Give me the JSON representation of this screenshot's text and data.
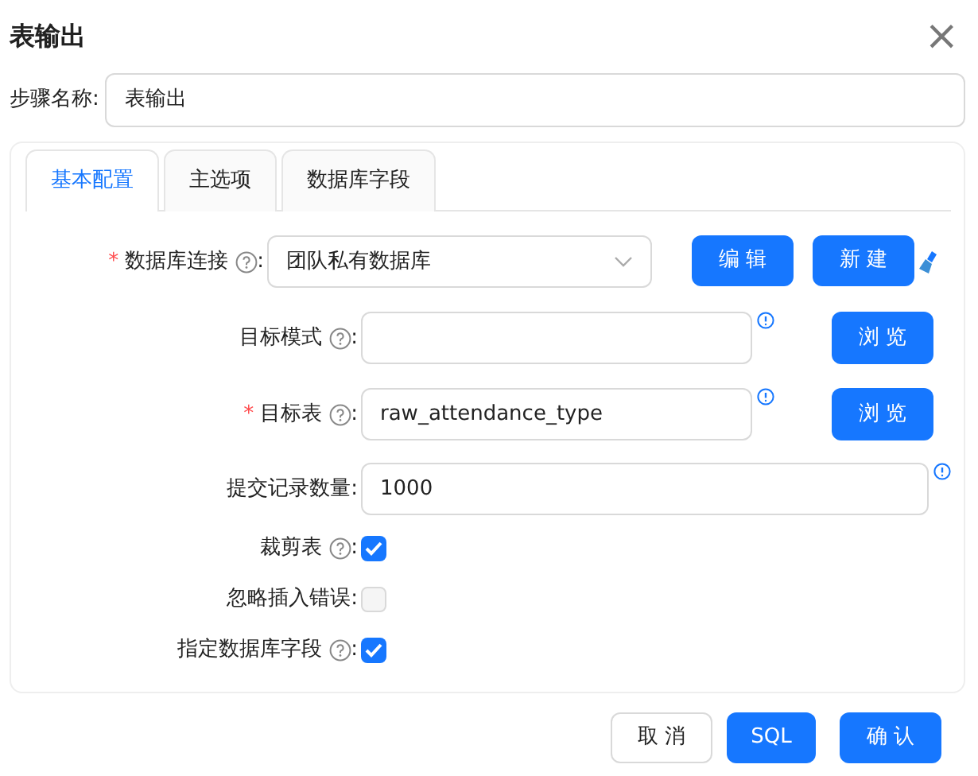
{
  "dialog": {
    "title": "表输出",
    "close": "×"
  },
  "step_name": {
    "label": "步骤名称:",
    "value": "表输出"
  },
  "tabs": [
    {
      "label": "基本配置",
      "selected": true
    },
    {
      "label": "主选项",
      "selected": false
    },
    {
      "label": "数据库字段",
      "selected": false
    }
  ],
  "fields": [
    {
      "kind": "select",
      "required_mark": "*",
      "label": "数据库连接",
      "help": true,
      "colon": ":",
      "value": "团队私有数据库",
      "buttons": [
        "编 辑",
        "新 建"
      ]
    },
    {
      "kind": "text",
      "label": "目标模式",
      "help": true,
      "colon": ":",
      "info": true,
      "buttons": [
        "浏 览"
      ]
    },
    {
      "kind": "text",
      "required_mark": "*",
      "label": "目标表",
      "help": true,
      "colon": ":",
      "value": "raw_attendance_type",
      "info": true,
      "buttons": [
        "浏 览"
      ]
    },
    {
      "kind": "wide",
      "label": "提交记录数量",
      "help": false,
      "colon": ":",
      "value": "1000",
      "info": true
    },
    {
      "kind": "checkbox",
      "label": "裁剪表",
      "help": true,
      "colon": ":",
      "checked": true
    },
    {
      "kind": "checkbox",
      "label": "忽略插入错误",
      "help": false,
      "colon": ":",
      "checked": false
    },
    {
      "kind": "checkbox",
      "label": "指定数据库字段",
      "help": true,
      "colon": ":",
      "checked": true
    }
  ],
  "footer_buttons": [
    {
      "label": "取 消",
      "kind": "default"
    },
    {
      "label": "SQL",
      "kind": "primary"
    },
    {
      "label": "确 认",
      "kind": "primary"
    }
  ]
}
